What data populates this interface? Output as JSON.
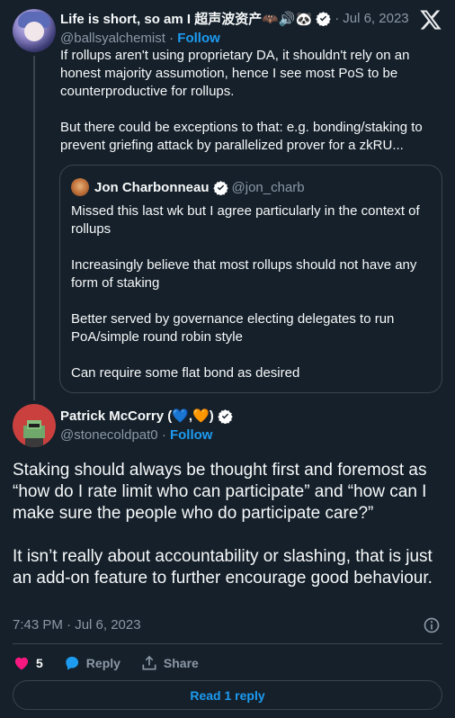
{
  "parent_tweet": {
    "display_name": "Life is short, so am I 超声波资产🦇🔊🐼",
    "handle": "@ballsyalchemist",
    "date": "Jul 6, 2023",
    "separator": "·",
    "follow_label": "Follow",
    "body": [
      "If rollups aren't using proprietary DA, it shouldn't rely on an honest majority assumotion, hence I see most PoS to be counterproductive for rollups.",
      "But there could be exceptions to that: e.g. bonding/staking to prevent griefing attack by parallelized prover for a zkRU..."
    ]
  },
  "quoted_tweet": {
    "display_name": "Jon Charbonneau",
    "handle": "@jon_charb",
    "body": [
      "Missed this last wk but I agree particularly in the context of rollups",
      "Increasingly believe that most rollups should not have any form of staking",
      "Better served by governance electing delegates to run PoA/simple round robin style",
      "Can require some flat bond as desired"
    ]
  },
  "main_tweet": {
    "display_name": "Patrick McCorry (💙,🧡)",
    "handle": "@stonecoldpat0",
    "separator": "·",
    "follow_label": "Follow",
    "body": [
      "Staking should always be thought first and foremost as “how do I rate limit who can participate” and “how can I make sure the people who do participate care?”",
      "It isn’t really about accountability or slashing, that is just an add-on feature to further encourage good behaviour."
    ],
    "timestamp": "7:43 PM · Jul 6, 2023",
    "like_count": "5",
    "reply_label": "Reply",
    "share_label": "Share",
    "read_replies_label": "Read 1 reply"
  },
  "icons": {
    "brand": "x-logo-icon",
    "verified": "verified-badge-icon",
    "like": "heart-icon",
    "reply": "speech-bubble-icon",
    "share": "share-upload-icon",
    "info": "info-icon"
  },
  "colors": {
    "background": "#15202b",
    "accent": "#1d9bf0",
    "muted": "#8b98a5",
    "like": "#f91880",
    "border": "#38444d"
  }
}
